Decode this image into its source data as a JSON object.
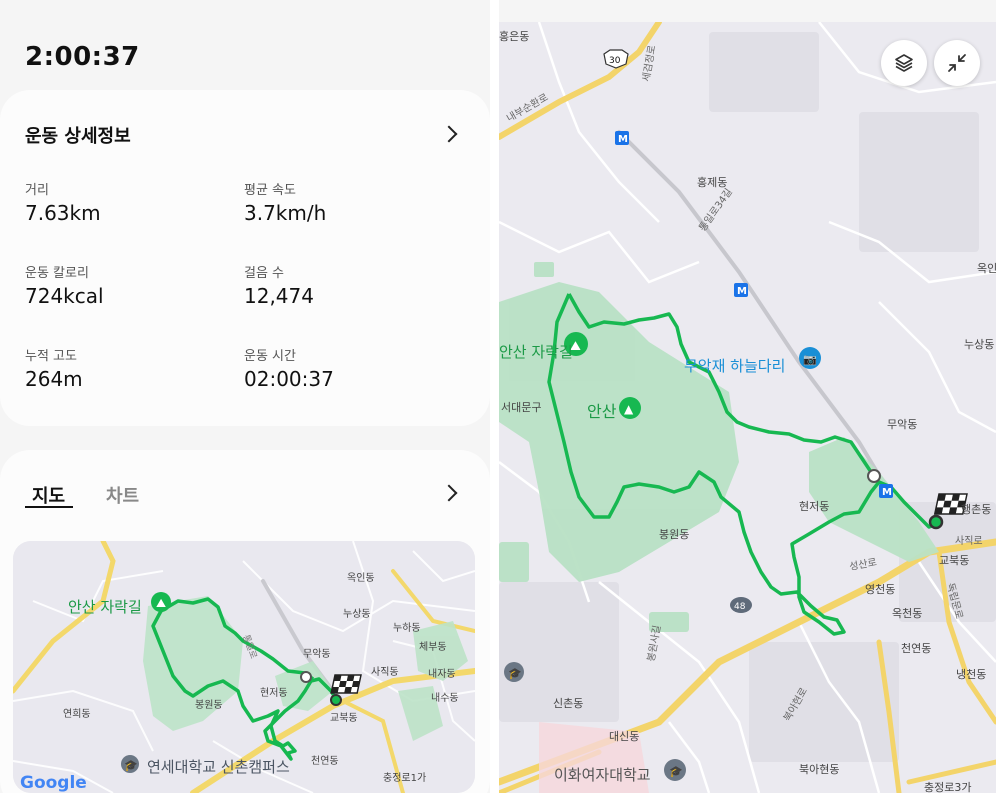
{
  "summary": {
    "duration": "2:00:37"
  },
  "details": {
    "title": "운동 상세정보",
    "stats": [
      {
        "label": "거리",
        "value": "7.63km"
      },
      {
        "label": "평균 속도",
        "value": "3.7km/h"
      },
      {
        "label": "운동 칼로리",
        "value": "724kcal"
      },
      {
        "label": "걸음 수",
        "value": "12,474"
      },
      {
        "label": "누적 고도",
        "value": "264m"
      },
      {
        "label": "운동 시간",
        "value": "02:00:37"
      }
    ]
  },
  "map_section": {
    "tabs": [
      {
        "label": "지도",
        "active": true
      },
      {
        "label": "차트",
        "active": false
      }
    ]
  },
  "mini_map": {
    "labels": {
      "trail": "안산 자락길",
      "okin": "옥인동",
      "nusang": "누상동",
      "nuha": "누하동",
      "chebu": "체부동",
      "muak": "무악동",
      "sajik": "사직동",
      "naeja": "내자동",
      "naesu": "내수동",
      "hyeonjeo": "현저동",
      "bongwon": "봉원동",
      "gyobuk": "교북동",
      "yeonhui": "연희동",
      "cheonyeon": "천연동",
      "yonsei": "연세대학교 신촌캠퍼스",
      "chungjeong": "충정로1가",
      "tongil": "통일로",
      "google": "Google"
    }
  },
  "big_map": {
    "labels": {
      "hongeun": "홍은동",
      "naebu": "내부순환로",
      "r30": "30",
      "sejeom": "세검정로",
      "hongje": "홍제동",
      "tongil34": "통일로34길",
      "okin": "옥인",
      "nusang": "누상동",
      "trail": "안산 자락길",
      "muakjae": "무악재 하늘다리",
      "seodaemun": "서대문구",
      "ansan": "안산",
      "muak": "무악동",
      "hyeonjeo": "현저동",
      "sajik_partial": "행촌동",
      "sajikro": "사직로",
      "gyobuk": "교북동",
      "bongwon": "봉원동",
      "seongsan": "성산로",
      "yeongcheon": "영천동",
      "dongnip": "독립문로",
      "okcheon": "옥천동",
      "r48": "48",
      "bongwonsa": "봉원사길",
      "cheonyeon": "천연동",
      "naengcheon": "냉천동",
      "sinchon": "신촌동",
      "daesin": "대신동",
      "bugahyeon": "북아현로",
      "ewha": "이화여자대학교",
      "buga": "북아현동",
      "chungjeong": "충정로3가",
      "metro": "M"
    },
    "buttons": {
      "layers": "layers-icon",
      "collapse": "collapse-icon"
    }
  },
  "colors": {
    "route": "#1db954",
    "park": "#b7e2c4",
    "road_major": "#f5d86b",
    "metro": "#1a73e8"
  }
}
